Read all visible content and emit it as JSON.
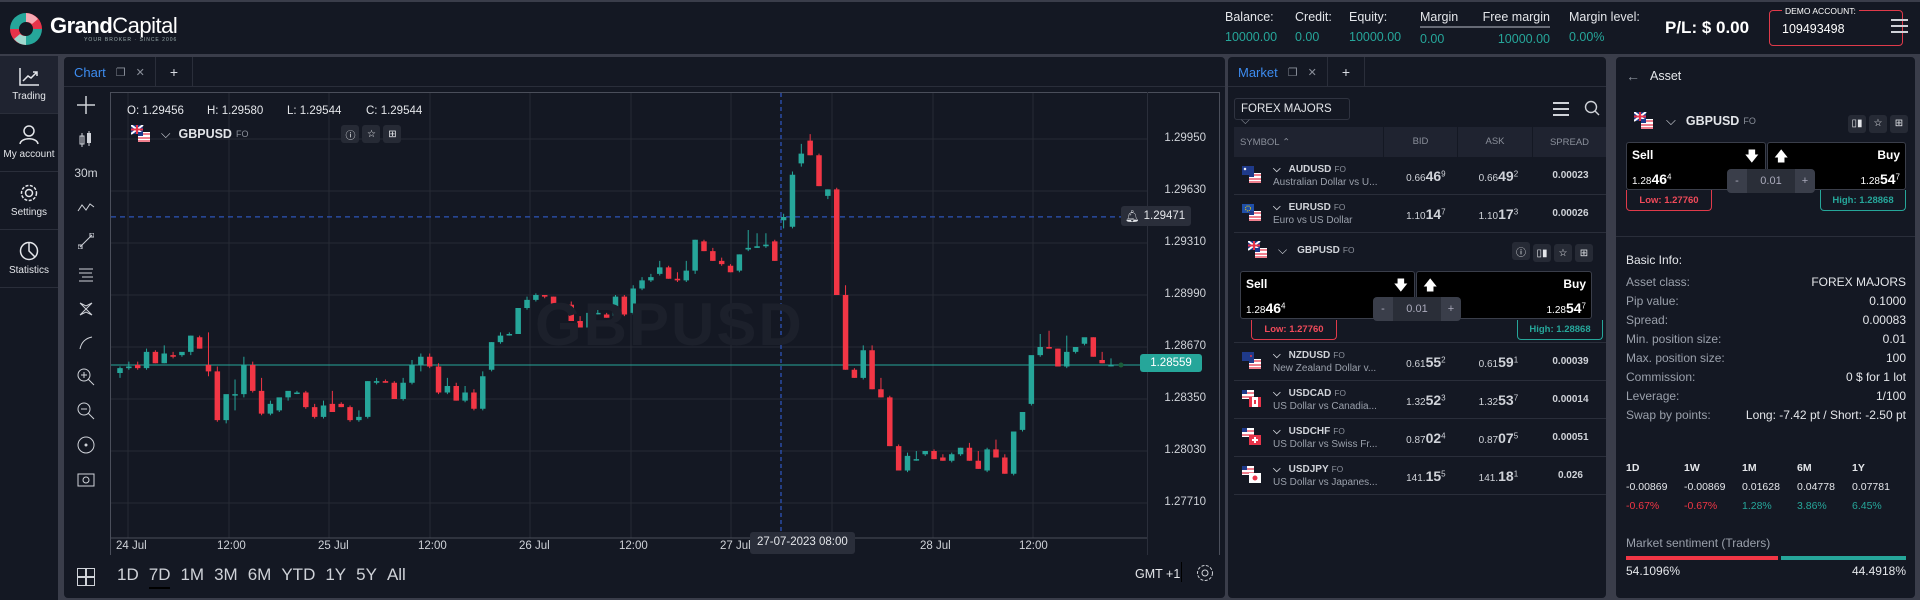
{
  "header": {
    "brand_bold": "Grand",
    "brand_light": "Capital",
    "tagline": "YOUR BROKER · SINCE 2006",
    "balance": {
      "label": "Balance:",
      "value": "10000.00"
    },
    "credit": {
      "label": "Credit:",
      "value": "0.00"
    },
    "equity": {
      "label": "Equity:",
      "value": "10000.00"
    },
    "margin": {
      "label": "Margin",
      "value": "0.00"
    },
    "free_margin": {
      "label": "Free margin",
      "value": "10000.00"
    },
    "margin_level": {
      "label": "Margin level:",
      "value": "0.00%"
    },
    "pl": "P/L:  $ 0.00",
    "demo_label": "DEMO ACCOUNT:",
    "demo_number": "109493498"
  },
  "nav": [
    {
      "label": "Trading",
      "icon": "trend-icon"
    },
    {
      "label": "My account",
      "icon": "user-icon"
    },
    {
      "label": "Settings",
      "icon": "gear-icon"
    },
    {
      "label": "Statistics",
      "icon": "pie-icon"
    }
  ],
  "chart_panel": {
    "tab_label": "Chart",
    "plus": "+",
    "timeframe": "30m",
    "ohlc": {
      "o": "O: 1.29456",
      "h": "H: 1.29580",
      "l": "L:  1.29544",
      "c": "C: 1.29544"
    },
    "symbol": "GBPUSD",
    "symbol_suffix": "FO",
    "watermark": "GBPUSD",
    "alert_price": "1.29471",
    "current_price": "1.28559",
    "crosshair_time": "27-07-2023 08:00",
    "ranges": [
      "1D",
      "7D",
      "1M",
      "3M",
      "6M",
      "YTD",
      "1Y",
      "5Y",
      "All"
    ],
    "selected_range": "7D",
    "timezone": "GMT +1"
  },
  "chart_data": {
    "type": "candlestick",
    "title": "GBPUSD",
    "interval": "30m",
    "y_ticks": [
      "1.29950",
      "1.29630",
      "1.29310",
      "1.28990",
      "1.28670",
      "1.28350",
      "1.28030",
      "1.27710"
    ],
    "x_ticks": [
      "24 Jul",
      "12:00",
      "25 Jul",
      "12:00",
      "26 Jul",
      "12:00",
      "27 Jul",
      "12:00",
      "28 Jul",
      "12:00"
    ],
    "ylim": [
      1.2752,
      1.301
    ],
    "grid": true,
    "alert_line": 1.29471,
    "last_price": 1.28559,
    "candles": [
      [
        1.2851,
        1.2855,
        1.2848,
        1.2854
      ],
      [
        1.2854,
        1.2858,
        1.2853,
        1.2855
      ],
      [
        1.2856,
        1.2858,
        1.2853,
        1.2854
      ],
      [
        1.2854,
        1.2866,
        1.2853,
        1.2864
      ],
      [
        1.2864,
        1.2865,
        1.2857,
        1.2857
      ],
      [
        1.2857,
        1.2868,
        1.2857,
        1.2863
      ],
      [
        1.2862,
        1.2864,
        1.286,
        1.2861
      ],
      [
        1.2862,
        1.2863,
        1.2861,
        1.2864
      ],
      [
        1.2864,
        1.2874,
        1.2862,
        1.2874
      ],
      [
        1.2873,
        1.2874,
        1.2866,
        1.2866
      ],
      [
        1.2856,
        1.2876,
        1.2849,
        1.2852
      ],
      [
        1.2852,
        1.2855,
        1.2821,
        1.2822
      ],
      [
        1.2822,
        1.283,
        1.282,
        1.2838
      ],
      [
        1.2838,
        1.2847,
        1.2828,
        1.2838
      ],
      [
        1.2838,
        1.2861,
        1.2836,
        1.2856
      ],
      [
        1.2856,
        1.2858,
        1.2839,
        1.284
      ],
      [
        1.284,
        1.2848,
        1.2825,
        1.2826
      ],
      [
        1.2826,
        1.2834,
        1.2825,
        1.2832
      ],
      [
        1.2828,
        1.2835,
        1.2827,
        1.2836
      ],
      [
        1.2836,
        1.2839,
        1.2834,
        1.284
      ],
      [
        1.2839,
        1.284,
        1.2838,
        1.2839
      ],
      [
        1.2839,
        1.284,
        1.2829,
        1.283
      ],
      [
        1.283,
        1.2832,
        1.2823,
        1.2824
      ],
      [
        1.2824,
        1.2834,
        1.2823,
        1.2831
      ],
      [
        1.2832,
        1.284,
        1.2827,
        1.2827
      ],
      [
        1.2832,
        1.2833,
        1.283,
        1.283
      ],
      [
        1.283,
        1.2831,
        1.2821,
        1.2822
      ],
      [
        1.2822,
        1.2828,
        1.2821,
        1.2824
      ],
      [
        1.2824,
        1.2846,
        1.2823,
        1.2846
      ],
      [
        1.2845,
        1.2848,
        1.2844,
        1.2846
      ],
      [
        1.2846,
        1.2847,
        1.2845,
        1.2845
      ],
      [
        1.2845,
        1.2846,
        1.2835,
        1.2835
      ],
      [
        1.2835,
        1.2848,
        1.2834,
        1.2845
      ],
      [
        1.2845,
        1.2859,
        1.2844,
        1.2856
      ],
      [
        1.2856,
        1.2863,
        1.2852,
        1.2861
      ],
      [
        1.2861,
        1.2863,
        1.2854,
        1.2855
      ],
      [
        1.2855,
        1.2857,
        1.2838,
        1.2839
      ],
      [
        1.2839,
        1.2848,
        1.2838,
        1.2843
      ],
      [
        1.2843,
        1.2845,
        1.2834,
        1.2834
      ],
      [
        1.2834,
        1.2843,
        1.2833,
        1.2839
      ],
      [
        1.2839,
        1.2841,
        1.2828,
        1.2829
      ],
      [
        1.2829,
        1.2852,
        1.2828,
        1.2849
      ],
      [
        1.2853,
        1.287,
        1.2852,
        1.287
      ],
      [
        1.287,
        1.2876,
        1.2869,
        1.2874
      ],
      [
        1.2875,
        1.2876,
        1.2874,
        1.2875
      ],
      [
        1.2875,
        1.2891,
        1.2875,
        1.2891
      ],
      [
        1.2891,
        1.2898,
        1.289,
        1.2896
      ],
      [
        1.2896,
        1.29,
        1.2895,
        1.2899
      ],
      [
        1.2899,
        1.2899,
        1.2897,
        1.2898
      ],
      [
        1.2898,
        1.2898,
        1.289,
        1.2891
      ],
      [
        1.2892,
        1.2893,
        1.2891,
        1.2891
      ],
      [
        1.2893,
        1.2895,
        1.2883,
        1.2883
      ],
      [
        1.2883,
        1.2886,
        1.2879,
        1.2879
      ],
      [
        1.2879,
        1.2891,
        1.2879,
        1.2888
      ],
      [
        1.2888,
        1.289,
        1.2887,
        1.2888
      ],
      [
        1.2887,
        1.2888,
        1.2885,
        1.2885
      ],
      [
        1.2886,
        1.2899,
        1.2885,
        1.2898
      ],
      [
        1.2898,
        1.2899,
        1.2886,
        1.2887
      ],
      [
        1.2888,
        1.2905,
        1.2887,
        1.2903
      ],
      [
        1.2903,
        1.291,
        1.2902,
        1.2908
      ],
      [
        1.2908,
        1.2912,
        1.2907,
        1.291
      ],
      [
        1.2912,
        1.292,
        1.2911,
        1.2916
      ],
      [
        1.2916,
        1.2917,
        1.2909,
        1.2909
      ],
      [
        1.2909,
        1.2913,
        1.2907,
        1.2908
      ],
      [
        1.2908,
        1.292,
        1.2907,
        1.2914
      ],
      [
        1.2914,
        1.2933,
        1.2912,
        1.2933
      ],
      [
        1.2932,
        1.2933,
        1.2926,
        1.2926
      ],
      [
        1.2926,
        1.2928,
        1.292,
        1.292
      ],
      [
        1.292,
        1.2922,
        1.2917,
        1.2918
      ],
      [
        1.2917,
        1.2918,
        1.2913,
        1.2913
      ],
      [
        1.2914,
        1.2924,
        1.2913,
        1.2924
      ],
      [
        1.2927,
        1.2939,
        1.2926,
        1.2928
      ],
      [
        1.2928,
        1.2937,
        1.2928,
        1.2929
      ],
      [
        1.2929,
        1.2937,
        1.2928,
        1.293
      ],
      [
        1.2932,
        1.2933,
        1.292,
        1.292
      ],
      [
        1.2945,
        1.2949,
        1.294,
        1.2947
      ],
      [
        1.2941,
        1.2975,
        1.294,
        1.2973
      ],
      [
        1.298,
        1.2992,
        1.2978,
        1.2986
      ],
      [
        1.2994,
        1.2998,
        1.2985,
        1.2985
      ],
      [
        1.2985,
        1.2986,
        1.2966,
        1.2966
      ],
      [
        1.296,
        1.2964,
        1.2958,
        1.2964
      ],
      [
        1.2964,
        1.2965,
        1.2899,
        1.2899
      ],
      [
        1.2899,
        1.2905,
        1.2853,
        1.2853
      ],
      [
        1.2853,
        1.2854,
        1.2848,
        1.2848
      ],
      [
        1.2848,
        1.2868,
        1.2847,
        1.2865
      ],
      [
        1.2865,
        1.2868,
        1.2841,
        1.2841
      ],
      [
        1.2841,
        1.2848,
        1.2836,
        1.2836
      ],
      [
        1.2836,
        1.2837,
        1.2806,
        1.2806
      ],
      [
        1.2806,
        1.2807,
        1.2791,
        1.2791
      ],
      [
        1.2791,
        1.2802,
        1.279,
        1.28
      ],
      [
        1.2798,
        1.2803,
        1.2797,
        1.2798
      ],
      [
        1.2801,
        1.2803,
        1.28,
        1.2803
      ],
      [
        1.2803,
        1.2804,
        1.2798,
        1.2798
      ],
      [
        1.2799,
        1.2801,
        1.2797,
        1.2797
      ],
      [
        1.2797,
        1.2802,
        1.2796,
        1.2801
      ],
      [
        1.2801,
        1.2805,
        1.28,
        1.2805
      ],
      [
        1.2805,
        1.2808,
        1.2797,
        1.2797
      ],
      [
        1.2797,
        1.2803,
        1.2792,
        1.2792
      ],
      [
        1.2791,
        1.2805,
        1.279,
        1.2804
      ],
      [
        1.2804,
        1.281,
        1.2799,
        1.2799
      ],
      [
        1.2799,
        1.2801,
        1.2789,
        1.2789
      ],
      [
        1.2789,
        1.2815,
        1.2788,
        1.2815
      ],
      [
        1.2816,
        1.2826,
        1.2815,
        1.2827
      ],
      [
        1.2832,
        1.2836,
        1.2831,
        1.2862
      ],
      [
        1.2862,
        1.2875,
        1.2861,
        1.2867
      ],
      [
        1.2867,
        1.2877,
        1.2866,
        1.2866
      ],
      [
        1.2866,
        1.2866,
        1.2855,
        1.2855
      ],
      [
        1.2855,
        1.2874,
        1.2854,
        1.2864
      ],
      [
        1.2864,
        1.2866,
        1.2863,
        1.2867
      ],
      [
        1.2869,
        1.2872,
        1.2868,
        1.2873
      ],
      [
        1.2873,
        1.2873,
        1.2861,
        1.2861
      ],
      [
        1.2859,
        1.2864,
        1.2857,
        1.2857
      ],
      [
        1.2856,
        1.286,
        1.2855,
        1.2856
      ]
    ]
  },
  "market": {
    "tab_label": "Market",
    "plus": "+",
    "filter": "FOREX MAJORS",
    "columns": [
      "SYMBOL",
      "BID",
      "ASK",
      "SPREAD"
    ],
    "rows": [
      {
        "symbol": "AUDUSD",
        "suffix": "FO",
        "desc": "Australian Dollar vs U...",
        "bid": [
          "0.66",
          "46",
          "9"
        ],
        "ask": [
          "0.66",
          "49",
          "2"
        ],
        "spread": "0.00023",
        "flag": "au"
      },
      {
        "symbol": "EURUSD",
        "suffix": "FO",
        "desc": "Euro vs US Dollar",
        "bid": [
          "1.10",
          "14",
          "7"
        ],
        "ask": [
          "1.10",
          "17",
          "3"
        ],
        "spread": "0.00026",
        "flag": "eu"
      },
      {
        "symbol": "NZDUSD",
        "suffix": "FO",
        "desc": "New Zealand Dollar v...",
        "bid": [
          "0.61",
          "55",
          "2"
        ],
        "ask": [
          "0.61",
          "59",
          "1"
        ],
        "spread": "0.00039",
        "flag": "nz"
      },
      {
        "symbol": "USDCAD",
        "suffix": "FO",
        "desc": "US Dollar vs Canadia...",
        "bid": [
          "1.32",
          "52",
          "3"
        ],
        "ask": [
          "1.32",
          "53",
          "7"
        ],
        "spread": "0.00014",
        "flag": "ca"
      },
      {
        "symbol": "USDCHF",
        "suffix": "FO",
        "desc": "US Dollar vs Swiss Fr...",
        "bid": [
          "0.87",
          "02",
          "4"
        ],
        "ask": [
          "0.87",
          "07",
          "5"
        ],
        "spread": "0.00051",
        "flag": "ch"
      },
      {
        "symbol": "USDJPY",
        "suffix": "FO",
        "desc": "US Dollar vs Japanes...",
        "bid": [
          "141.",
          "15",
          "5"
        ],
        "ask": [
          "141.",
          "18",
          "1"
        ],
        "spread": "0.026",
        "flag": "jp"
      }
    ],
    "expanded": {
      "symbol": "GBPUSD",
      "suffix": "FO",
      "sell_label": "Sell",
      "buy_label": "Buy",
      "sell": [
        "1.28",
        "46",
        "4"
      ],
      "buy": [
        "1.28",
        "54",
        "7"
      ],
      "qty": "0.01",
      "minus": "-",
      "plus": "+",
      "low": "Low: 1.27760",
      "high": "High: 1.28868"
    }
  },
  "asset": {
    "title": "Asset",
    "symbol": "GBPUSD",
    "suffix": "FO",
    "sell_label": "Sell",
    "buy_label": "Buy",
    "sell": [
      "1.28",
      "46",
      "4"
    ],
    "buy": [
      "1.28",
      "54",
      "7"
    ],
    "qty": "0.01",
    "minus": "-",
    "plus": "+",
    "low": "Low: 1.27760",
    "high": "High: 1.28868",
    "basic_info_title": "Basic Info:",
    "info": [
      {
        "k": "Asset class:",
        "v": "FOREX MAJORS"
      },
      {
        "k": "Pip value:",
        "v": "0.1000"
      },
      {
        "k": "Spread:",
        "v": "0.00083"
      },
      {
        "k": "Min. position size:",
        "v": "0.01"
      },
      {
        "k": "Max. position size:",
        "v": "100"
      },
      {
        "k": "Commission:",
        "v": "0 $ for 1 lot"
      },
      {
        "k": "Leverage:",
        "v": "1/100"
      },
      {
        "k": "Swap by points:",
        "v": "Long: -7.42 pt / Short: -2.50 pt"
      }
    ],
    "performance": [
      {
        "period": "1D",
        "change": "-0.00869",
        "pct": "-0.67%",
        "dir": "down"
      },
      {
        "period": "1W",
        "change": "-0.00869",
        "pct": "-0.67%",
        "dir": "down"
      },
      {
        "period": "1M",
        "change": "0.01628",
        "pct": "1.28%",
        "dir": "up"
      },
      {
        "period": "6M",
        "change": "0.04778",
        "pct": "3.86%",
        "dir": "up"
      },
      {
        "period": "1Y",
        "change": "0.07781",
        "pct": "6.45%",
        "dir": "up"
      }
    ],
    "sentiment_title": "Market sentiment (Traders)",
    "sentiment_sell_pct": "54.1096%",
    "sentiment_buy_pct": "44.4918%",
    "sentiment_sell_value": 54.1096,
    "sentiment_buy_value": 44.4918
  },
  "colors": {
    "up": "#26a69a",
    "down": "#f23645",
    "accent": "#3d8cf0",
    "alert": "#e03a4a"
  }
}
